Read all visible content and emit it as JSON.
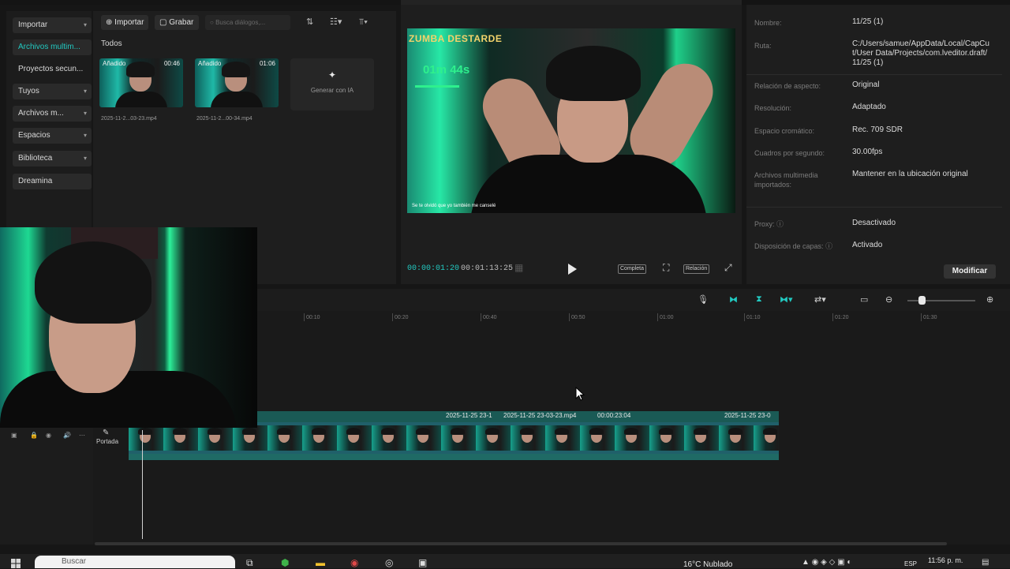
{
  "sidebar": {
    "items": [
      {
        "label": "Importar",
        "chevron": true
      },
      {
        "label": "Archivos multim...",
        "chevron": false
      },
      {
        "label": "Proyectos secun...",
        "chevron": false
      },
      {
        "label": "Tuyos",
        "chevron": true
      },
      {
        "label": "Archivos m...",
        "chevron": true
      },
      {
        "label": "Espacios",
        "chevron": true
      },
      {
        "label": "Biblioteca",
        "chevron": true
      },
      {
        "label": "Dreamina",
        "chevron": false
      }
    ]
  },
  "media": {
    "import_label": "Importar",
    "record_label": "Grabar",
    "search_placeholder": "Busca diálogos,...",
    "section_label": "Todos",
    "clips": [
      {
        "badge": "Añadido",
        "duration": "00:46",
        "name": "2025-11-2...03-23.mp4"
      },
      {
        "badge": "Añadido",
        "duration": "01:06",
        "name": "2025-11-2...00-34.mp4"
      }
    ],
    "generate_label": "Generar con IA"
  },
  "player": {
    "overlay_banner": "ZUMBA DESTARDE",
    "overlay_timer": "01m 44s",
    "overlay_caption": "Se te olvidó que yo también me canselé",
    "current_time": "00:00:01:20",
    "total_time": "00:01:13:25",
    "full_label": "Completa",
    "ratio_label": "Relación"
  },
  "details": {
    "rows": [
      {
        "label": "Nombre:",
        "value": "11/25 (1)"
      },
      {
        "label": "Ruta:",
        "value": "C:/Users/samue/AppData/Local/CapCut/User Data/Projects/com.lveditor.draft/11/25 (1)"
      },
      {
        "label": "Relación de aspecto:",
        "value": "Original"
      },
      {
        "label": "Resolución:",
        "value": "Adaptado"
      },
      {
        "label": "Espacio cromático:",
        "value": "Rec. 709 SDR"
      },
      {
        "label": "Cuadros por segundo:",
        "value": "30.00fps"
      },
      {
        "label": "Archivos multimedia importados:",
        "value": "Mantener en la ubicación original"
      },
      {
        "label": "Proxy:",
        "value": "Desactivado"
      },
      {
        "label": "Disposición de capas:",
        "value": "Activado"
      }
    ],
    "modify_label": "Modificar"
  },
  "timeline": {
    "ruler": [
      "00:10",
      "00:20",
      "00:40",
      "00:50",
      "01:00",
      "01:10",
      "01:20",
      "01:30"
    ],
    "clip_labels": [
      "2025-11-25 23-1",
      "2025-11-25 23-03-23.mp4",
      "00:00:23:04",
      "2025-11-25 23-0"
    ],
    "cover_label": "Portada",
    "zoom_fraction": 0.2
  },
  "taskbar": {
    "search_placeholder": "Buscar",
    "weather": "16°C  Nublado",
    "lang": "ESP",
    "time": "11:56 p. m."
  },
  "colors": {
    "accent": "#22c9c1",
    "panel": "#1e1e1e",
    "background": "#161616"
  }
}
